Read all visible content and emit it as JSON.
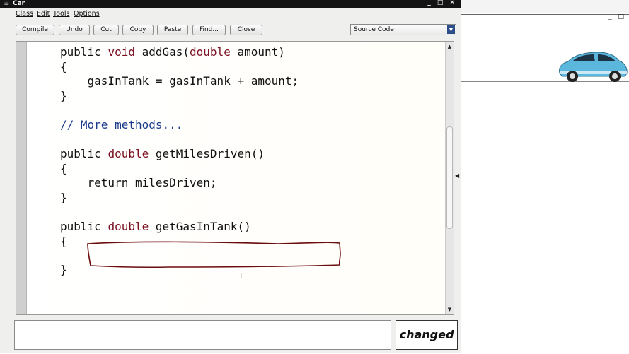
{
  "window": {
    "title": "Car",
    "menu": [
      "Class",
      "Edit",
      "Tools",
      "Options"
    ],
    "toolbar": {
      "buttons": [
        "Compile",
        "Undo",
        "Cut",
        "Copy",
        "Paste",
        "Find...",
        "Close"
      ],
      "view_select": "Source Code"
    },
    "editor": {
      "lines": [
        {
          "kw": "",
          "pre": "public ",
          "kw2": "void",
          "post": " addGas(",
          "kw3": "double",
          "tail": " amount)"
        },
        {
          "text": "{"
        },
        {
          "text": "    gasInTank = gasInTank + amount;"
        },
        {
          "text": "}"
        },
        {
          "comment": "// More methods..."
        },
        {
          "pre": "public ",
          "kw2": "double",
          "post": " getMilesDriven()"
        },
        {
          "text": "{"
        },
        {
          "text": "    return milesDriven;"
        },
        {
          "text": "}"
        },
        {
          "pre": "public ",
          "kw2": "double",
          "post": " getGasInTank()"
        },
        {
          "text": "{"
        },
        {
          "text": "}"
        }
      ]
    },
    "status": "changed"
  },
  "colors": {
    "keyword": "#7a1020",
    "comment": "#1a3a8a",
    "annotation": "#6b0d0d"
  },
  "icons": [
    "bluej-window-icon",
    "car-image",
    "scroll-up-icon",
    "scroll-down-icon",
    "dropdown-arrow-icon",
    "collapse-arrow-icon",
    "i-beam-cursor-icon"
  ]
}
